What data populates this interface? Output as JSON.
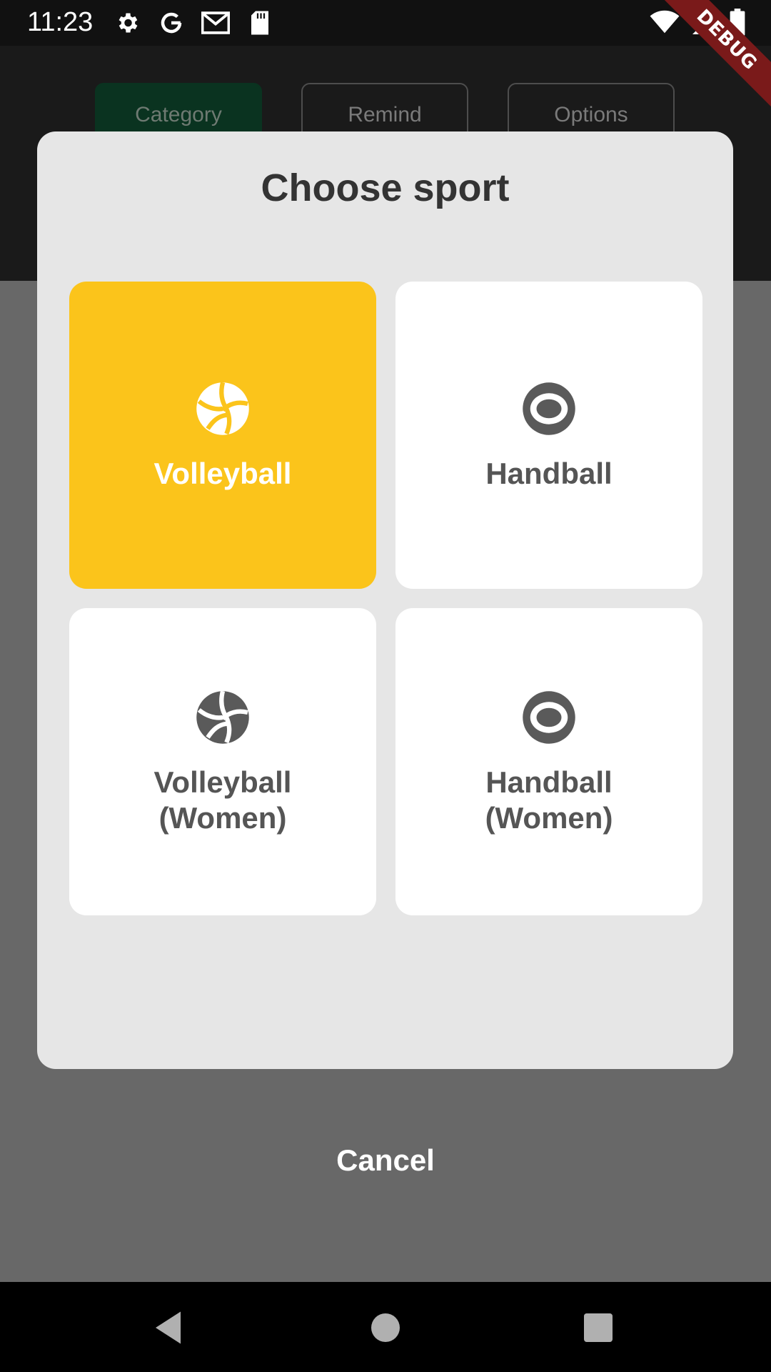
{
  "status_bar": {
    "time": "11:23",
    "left_icons": [
      "gear-icon",
      "google-icon",
      "gmail-icon",
      "sd-card-icon"
    ],
    "right_icons": [
      "wifi-icon",
      "signal-icon",
      "battery-icon"
    ]
  },
  "debug_banner": "DEBUG",
  "tabs": [
    {
      "label": "Category",
      "active": true
    },
    {
      "label": "Remind",
      "active": false
    },
    {
      "label": "Options",
      "active": false
    }
  ],
  "dialog": {
    "title": "Choose sport",
    "options": [
      {
        "label": "Volleyball",
        "icon": "volleyball-icon",
        "selected": true
      },
      {
        "label": "Handball",
        "icon": "handball-icon",
        "selected": false
      },
      {
        "label": "Volleyball\n(Women)",
        "icon": "volleyball-icon",
        "selected": false
      },
      {
        "label": "Handball\n(Women)",
        "icon": "handball-icon",
        "selected": false
      }
    ]
  },
  "cancel_label": "Cancel",
  "colors": {
    "accent": "#fbc41b",
    "active_tab": "#0a3320",
    "dialog_bg": "#e6e6e6",
    "scrim": "#686868"
  }
}
